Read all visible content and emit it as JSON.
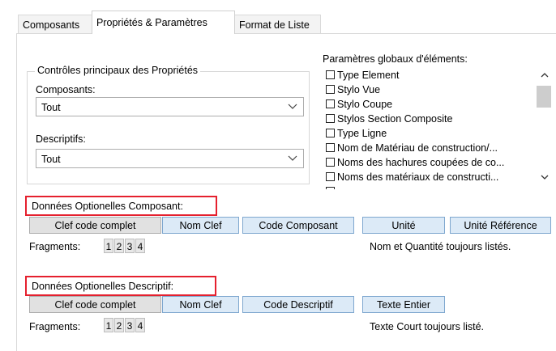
{
  "tabs": [
    "Composants",
    "Propriétés & Paramètres",
    "Format de Liste"
  ],
  "main_controls": {
    "legend": "Contrôles principaux des Propriétés",
    "composants_label": "Composants:",
    "composants_value": "Tout",
    "descriptifs_label": "Descriptifs:",
    "descriptifs_value": "Tout"
  },
  "global_params": {
    "label": "Paramètres globaux d'éléments:",
    "items": [
      "Type Element",
      "Stylo Vue",
      "Stylo Coupe",
      "Stylos Section Composite",
      "Type Ligne",
      "Nom de Matériau de construction/...",
      "Noms des hachures coupées de co...",
      "Noms des matériaux de constructi..."
    ]
  },
  "composant_section": {
    "title": "Données Optionelles Composant:",
    "buttons": [
      "Clef code complet",
      "Nom Clef",
      "Code Composant",
      "Unité",
      "Unité Référence"
    ],
    "fragments_label": "Fragments:",
    "fragments": [
      "1",
      "2",
      "3",
      "4"
    ],
    "note": "Nom et Quantité toujours listés."
  },
  "descriptif_section": {
    "title": "Données Optionelles Descriptif:",
    "buttons": [
      "Clef code complet",
      "Nom Clef",
      "Code Descriptif",
      "Texte Entier"
    ],
    "fragments_label": "Fragments:",
    "fragments": [
      "1",
      "2",
      "3",
      "4"
    ],
    "note": "Texte Court toujours listé."
  }
}
